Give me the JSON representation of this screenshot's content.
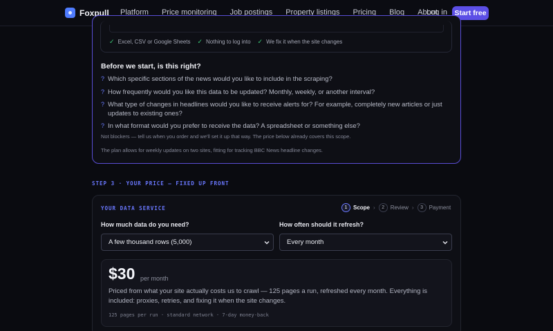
{
  "nav": {
    "brand": "Foxpull",
    "links": [
      "Platform",
      "Price monitoring",
      "Job postings",
      "Property listings",
      "Pricing",
      "Blog",
      "About"
    ],
    "login": "Log in",
    "cta": "Start free"
  },
  "features": [
    {
      "label": "Excel, CSV or Google Sheets",
      "icon": "check-icon"
    },
    {
      "label": "Nothing to log into",
      "icon": "check-icon"
    },
    {
      "label": "We fix it when the site changes",
      "icon": "check-icon"
    }
  ],
  "questions": {
    "title": "Before we start, is this right?",
    "items": [
      "Which specific sections of the news would you like to include in the scraping?",
      "How frequently would you like this data to be updated? Monthly, weekly, or another interval?",
      "What type of changes in headlines would you like to receive alerts for? For example, completely new articles or just updates to existing ones?",
      "In what format would you prefer to receive the data? A spreadsheet or something else?"
    ],
    "note": "Not blockers — tell us when you order and we'll set it up that way. The price below already covers this scope.",
    "plan_note": "The plan allows for weekly updates on two sites, fitting for tracking BBC News headline changes."
  },
  "step_label": "STEP 3 · YOUR PRICE — FIXED UP FRONT",
  "service": {
    "label": "YOUR DATA SERVICE",
    "steps": [
      {
        "num": "1",
        "name": "Scope",
        "active": true
      },
      {
        "num": "2",
        "name": "Review",
        "active": false
      },
      {
        "num": "3",
        "name": "Payment",
        "active": false
      }
    ],
    "data_label": "How much data do you need?",
    "data_value": "A few thousand rows (5,000)",
    "refresh_label": "How often should it refresh?",
    "refresh_value": "Every month",
    "price": "$30",
    "price_unit": "per month",
    "price_desc": "Priced from what your site actually costs us to crawl — 125 pages a run, refreshed every month. Everything is included: proxies, retries, and fixing it when the site changes.",
    "price_meta": "125 pages per run · standard network · 7-day money-back"
  },
  "colors": {
    "accent": "#5c4fe6",
    "accent_label": "#6a78ff",
    "check": "#3ccf7a",
    "background": "#0a0b10"
  }
}
